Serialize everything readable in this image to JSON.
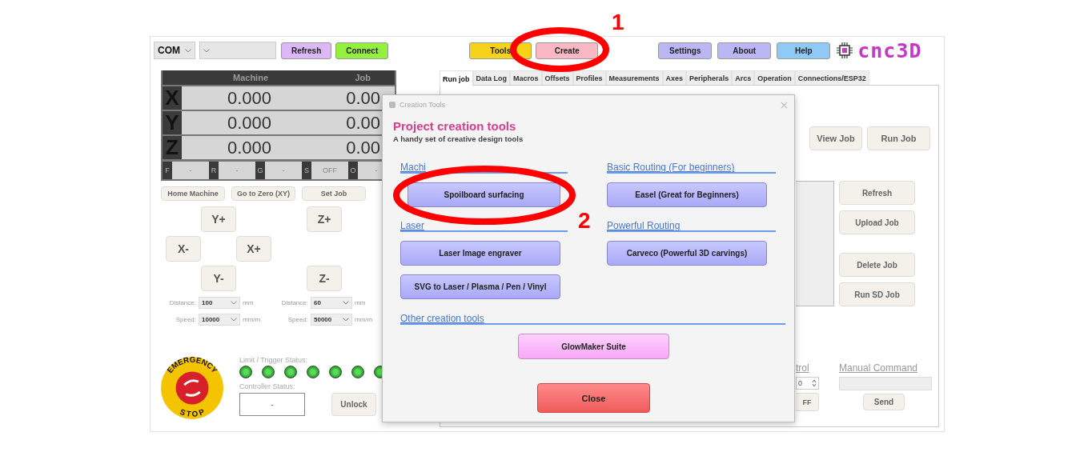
{
  "toolbar": {
    "port": "COM",
    "connection_buttons": [
      {
        "label": "Refresh",
        "color": "#dcb8f7"
      },
      {
        "label": "Connect",
        "color": "#93f03c"
      }
    ],
    "tool_buttons": [
      {
        "label": "Tools",
        "color": "#f7d21a"
      },
      {
        "label": "Create",
        "color": "#f9b8c4"
      }
    ],
    "menu_buttons": [
      {
        "label": "Settings",
        "color": "#bbb6f4"
      },
      {
        "label": "About",
        "color": "#bbb6f4"
      },
      {
        "label": "Help",
        "color": "#8fcaf6"
      }
    ],
    "logo": "cnc3D"
  },
  "dro": {
    "columns": [
      "Machine",
      "Job"
    ],
    "axes": [
      {
        "axis": "X",
        "machine": "0.000",
        "job": "0.00"
      },
      {
        "axis": "Y",
        "machine": "0.000",
        "job": "0.00"
      },
      {
        "axis": "Z",
        "machine": "0.000",
        "job": "0.00"
      }
    ],
    "status": [
      {
        "label": "F",
        "value": "-"
      },
      {
        "label": "R",
        "value": "-"
      },
      {
        "label": "G",
        "value": "-"
      },
      {
        "label": "S",
        "value": "OFF"
      },
      {
        "label": "O",
        "value": "-"
      }
    ]
  },
  "machine_buttons": [
    "Home Machine",
    "Go to Zero (XY)",
    "Set Job"
  ],
  "jog_buttons": [
    "Y+",
    "Z+",
    "X-",
    "X+",
    "Y-",
    "Z-"
  ],
  "jog_settings": [
    {
      "label": "Distance:",
      "value": "100",
      "unit": "mm"
    },
    {
      "label": "Distance:",
      "value": "60",
      "unit": "mm"
    },
    {
      "label": "Speed:",
      "value": "10000",
      "unit": "mm/m"
    },
    {
      "label": "Speed:",
      "value": "50000",
      "unit": "mm/m"
    }
  ],
  "emergency_stop": {
    "top": "EMERGENCY",
    "bottom": "STOP"
  },
  "limit_status": {
    "label": "Limit / Trigger Status:",
    "leds": [
      {
        "on": true
      },
      {
        "on": true
      },
      {
        "on": true
      },
      {
        "on": true
      },
      {
        "on": true
      },
      {
        "on": true
      },
      {
        "on": true
      }
    ]
  },
  "controller_status": {
    "label": "Controller Status:",
    "value": "-"
  },
  "unlock": "Unlock",
  "tabs": [
    {
      "label": "Run job",
      "selected": true
    },
    {
      "label": "Data Log",
      "selected": false
    },
    {
      "label": "Macros",
      "selected": false
    },
    {
      "label": "Offsets",
      "selected": false
    },
    {
      "label": "Profiles",
      "selected": false
    },
    {
      "label": "Measurements",
      "selected": false
    },
    {
      "label": "Axes",
      "selected": false
    },
    {
      "label": "Peripherals",
      "selected": false
    },
    {
      "label": "Arcs",
      "selected": false
    },
    {
      "label": "Operation",
      "selected": false
    },
    {
      "label": "Connections/ESP32",
      "selected": false
    }
  ],
  "run_job": {
    "job_buttons": [
      "View Job",
      "Run Job"
    ],
    "sd_buttons": [
      "Refresh",
      "Upload Job",
      "Delete Job",
      "Run SD Job"
    ],
    "control": {
      "heading": "trol",
      "spinner": "0",
      "toggle": "FF"
    },
    "manual_command": {
      "heading": "Manual Command",
      "button": "Send"
    }
  },
  "dialog": {
    "title": "Creation Tools",
    "heading": "Project creation tools",
    "subtitle": "A handy set of creative design tools",
    "sections": [
      {
        "heading": "Machi",
        "buttons": [
          "Spoilboard surfacing"
        ]
      },
      {
        "heading": "Basic Routing (For beginners)",
        "buttons": [
          "Easel (Great for Beginners)"
        ]
      },
      {
        "heading": "Laser",
        "buttons": [
          "Laser Image engraver",
          "SVG to Laser / Plasma / Pen / Vinyl"
        ]
      },
      {
        "heading": "Powerful Routing",
        "buttons": [
          "Carveco (Powerful 3D carvings)"
        ]
      }
    ],
    "other": {
      "heading": "Other creation tools",
      "button": "GlowMaker Suite"
    },
    "close": "Close"
  },
  "annotations": [
    {
      "label": "1"
    },
    {
      "label": "2"
    }
  ]
}
